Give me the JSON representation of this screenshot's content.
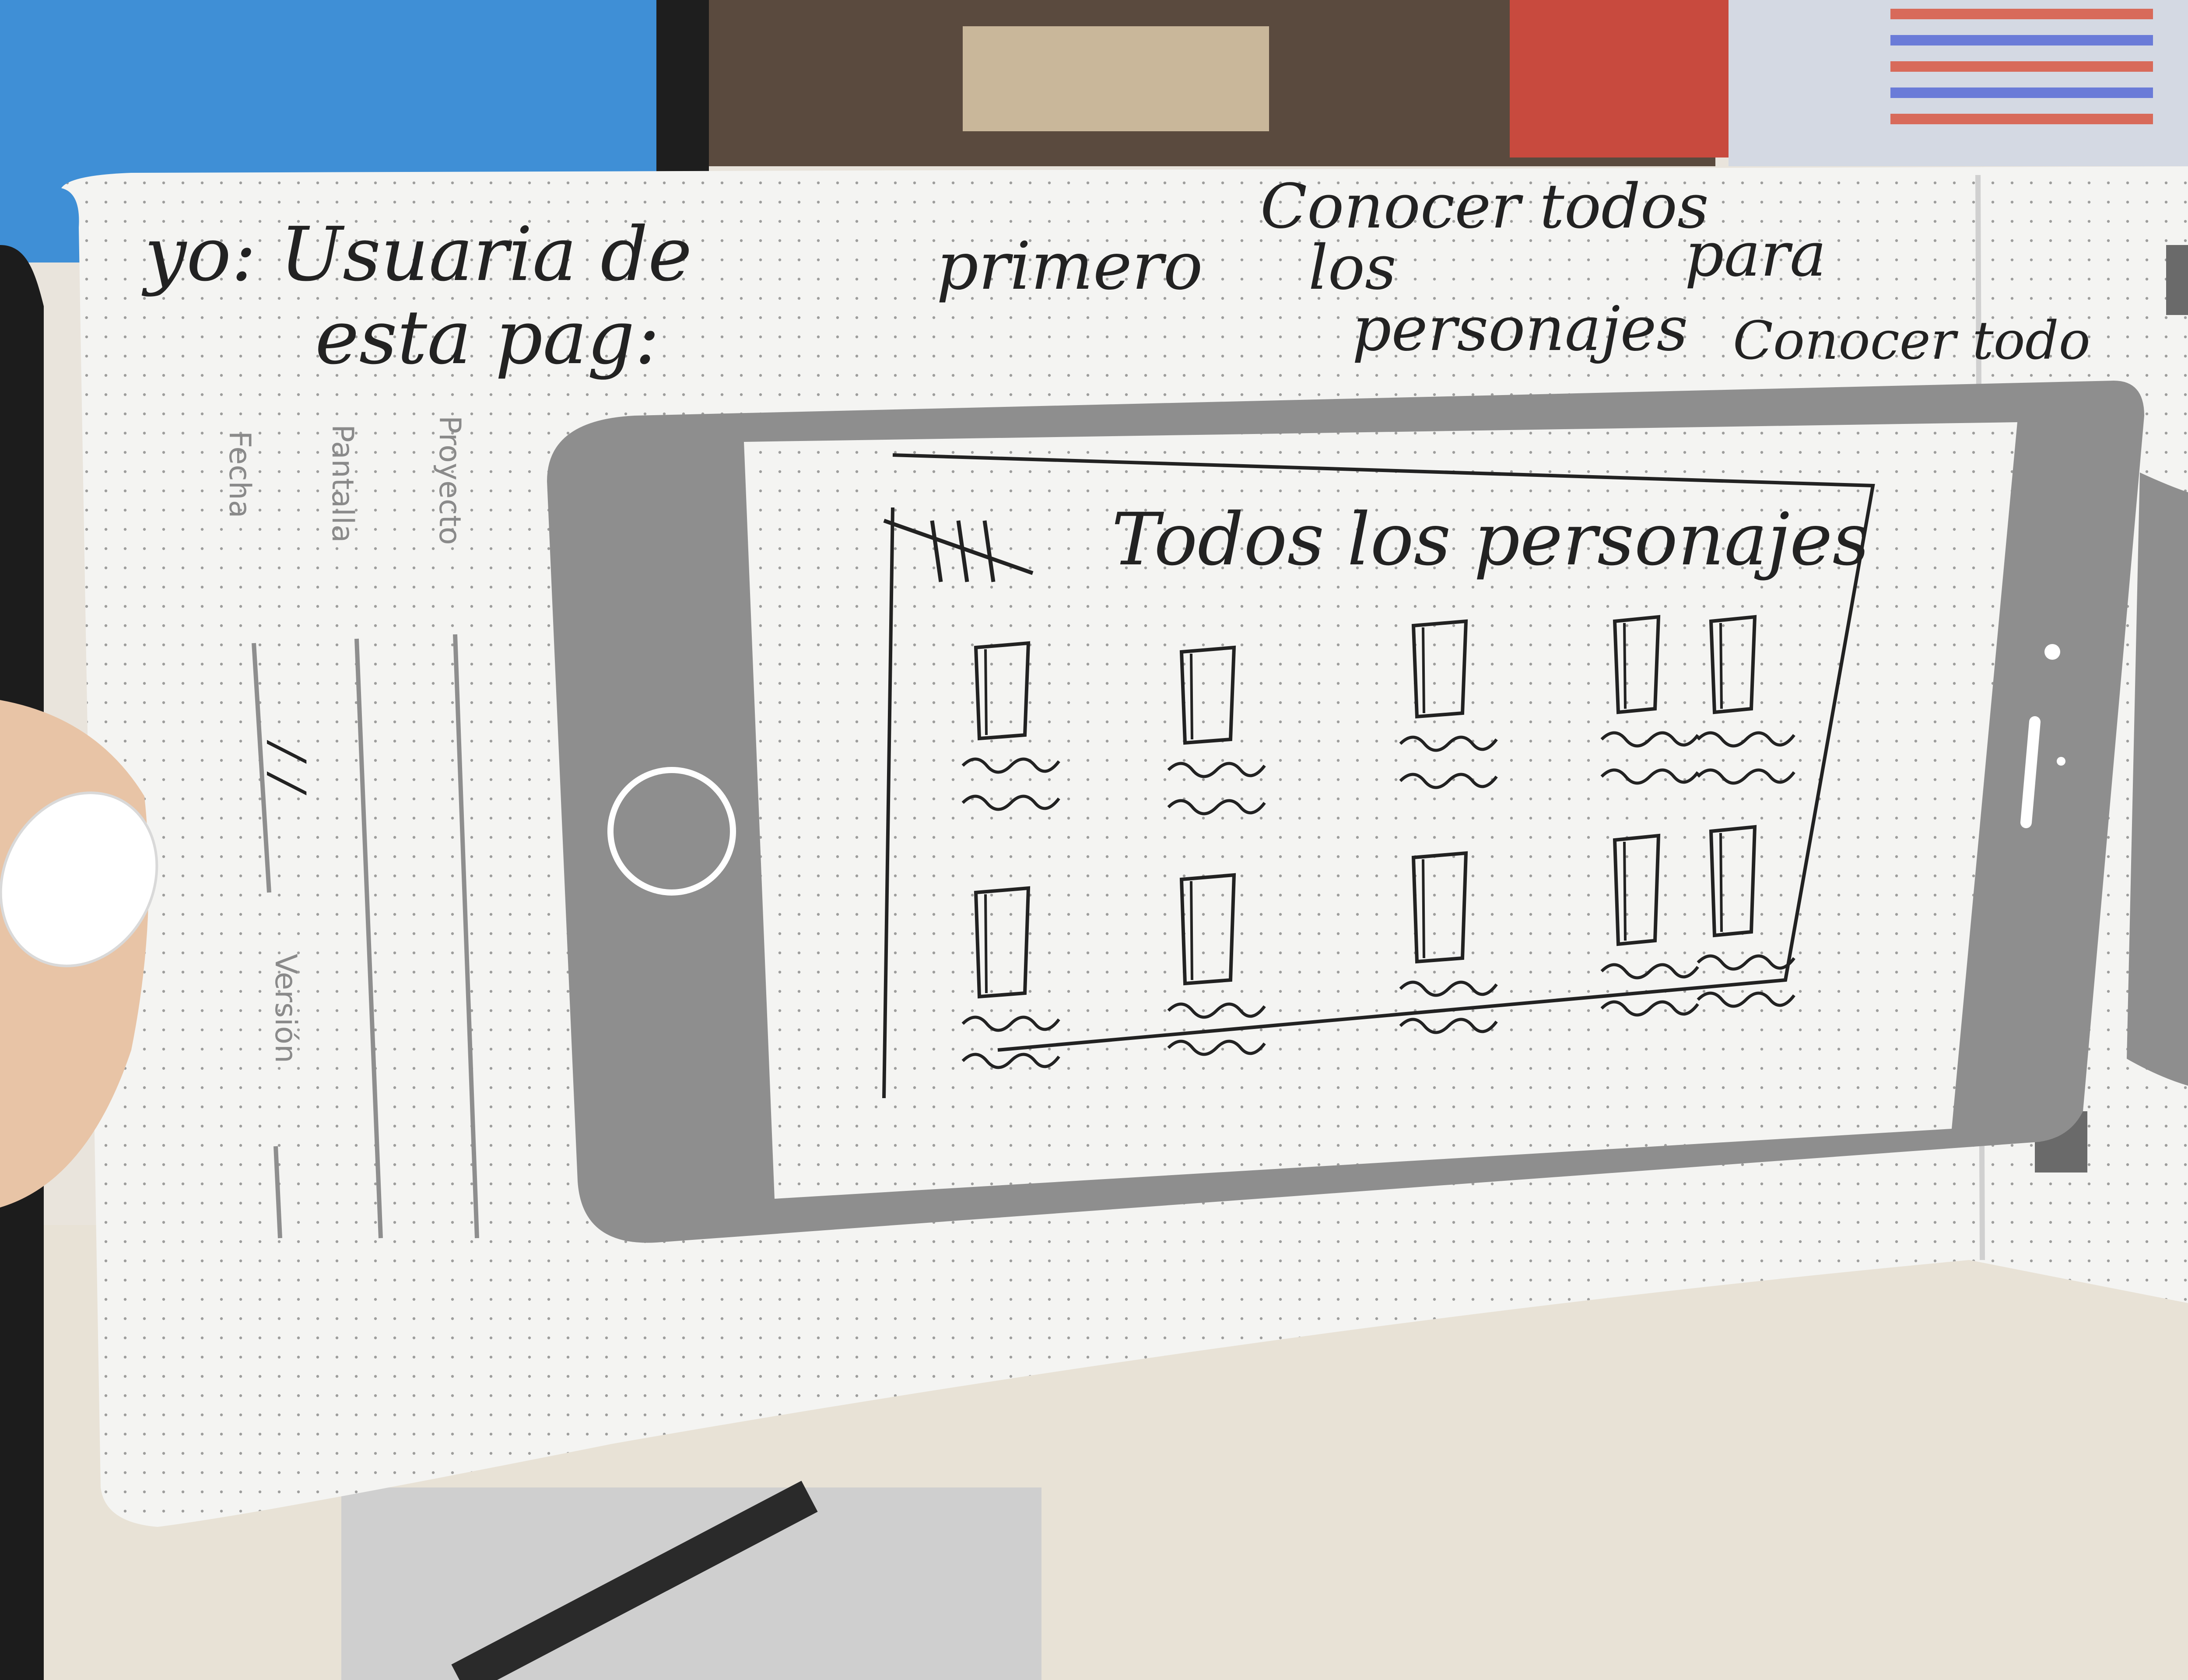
{
  "sketch": {
    "note_user": {
      "line1": "yo: Usuaria de",
      "line2": "esta pag:"
    },
    "note_goal": {
      "primer_word": "primero",
      "line_top": "Conocer todos",
      "line_los": "los",
      "line_personajes": "personajes",
      "line_para": "para",
      "line_conocer": "Conocer todo"
    },
    "form_labels": {
      "proyecto": "Proyecto",
      "pantalla": "Pantalla",
      "fecha": "Fecha",
      "fecha_value": "/ /",
      "version": "Versión"
    },
    "wireframe": {
      "menu_icon": "hamburger-menu-icon",
      "title": "Todos los personajes",
      "grid_rows": 2,
      "grid_cols": 5
    }
  },
  "colors": {
    "paper": "#f4f4f2",
    "phone_gray": "#8e8e8e",
    "ink": "#222222",
    "desk": "#e9e4dc",
    "monitor_blue": "#3f8fd6"
  }
}
